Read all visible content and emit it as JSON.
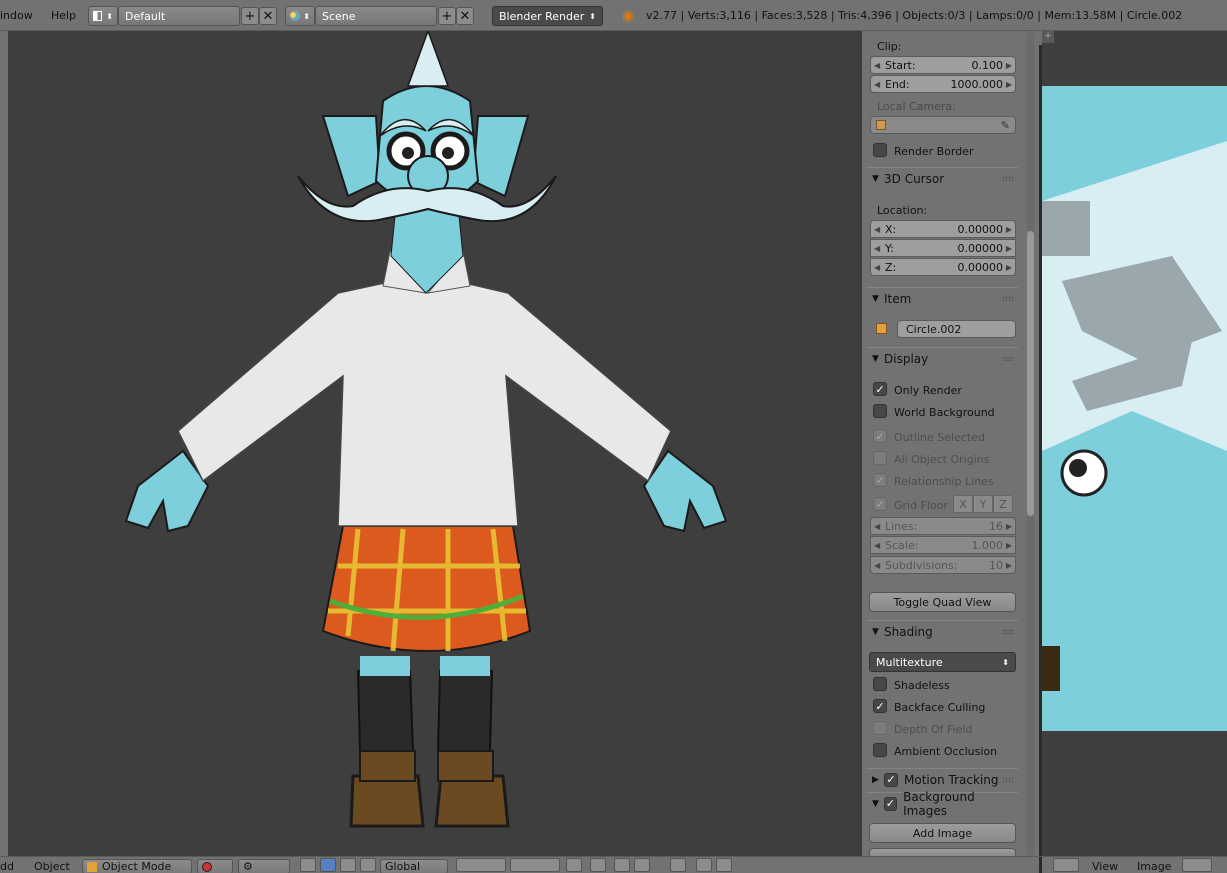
{
  "topbar": {
    "menu_window": "indow",
    "menu_help": "Help",
    "layout": "Default",
    "scene": "Scene",
    "engine": "Blender Render",
    "status": "v2.77 | Verts:3,116 | Faces:3,528 | Tris:4,396 | Objects:0/3 | Lamps:0/0 | Mem:13.58M | Circle.002"
  },
  "panel": {
    "clip_label": "Clip:",
    "clip_start_label": "Start:",
    "clip_start_value": "0.100",
    "clip_end_label": "End:",
    "clip_end_value": "1000.000",
    "local_camera_label": "Local Camera:",
    "render_border": "Render Border",
    "cursor_header": "3D Cursor",
    "location_label": "Location:",
    "x_label": "X:",
    "x_value": "0.00000",
    "y_label": "Y:",
    "y_value": "0.00000",
    "z_label": "Z:",
    "z_value": "0.00000",
    "item_header": "Item",
    "item_name": "Circle.002",
    "display_header": "Display",
    "only_render": "Only Render",
    "world_background": "World Background",
    "outline_selected": "Outline Selected",
    "all_object_origins": "All Object Origins",
    "relationship_lines": "Relationship Lines",
    "grid_floor": "Grid Floor",
    "axis_x": "X",
    "axis_y": "Y",
    "axis_z": "Z",
    "lines_label": "Lines:",
    "lines_value": "16",
    "scale_label": "Scale:",
    "scale_value": "1.000",
    "subdiv_label": "Subdivisions:",
    "subdiv_value": "10",
    "toggle_quad": "Toggle Quad View",
    "shading_header": "Shading",
    "shading_mode": "Multitexture",
    "shadeless": "Shadeless",
    "backface_culling": "Backface Culling",
    "depth_of_field": "Depth Of Field",
    "ambient_occlusion": "Ambient Occlusion",
    "motion_tracking": "Motion Tracking",
    "background_images": "Background Images",
    "add_image": "Add Image"
  },
  "bottombar": {
    "add": "dd",
    "object": "Object",
    "mode": "Object Mode",
    "orientation": "Global",
    "view": "View",
    "image": "Image"
  },
  "colors": {
    "skin": "#7ecfdc",
    "shirt": "#e8e8e8",
    "kilt": "#dd5a1e",
    "kilt_lines": "#e6c533",
    "kilt_green": "#4fae3a",
    "boots": "#6b4a22"
  }
}
